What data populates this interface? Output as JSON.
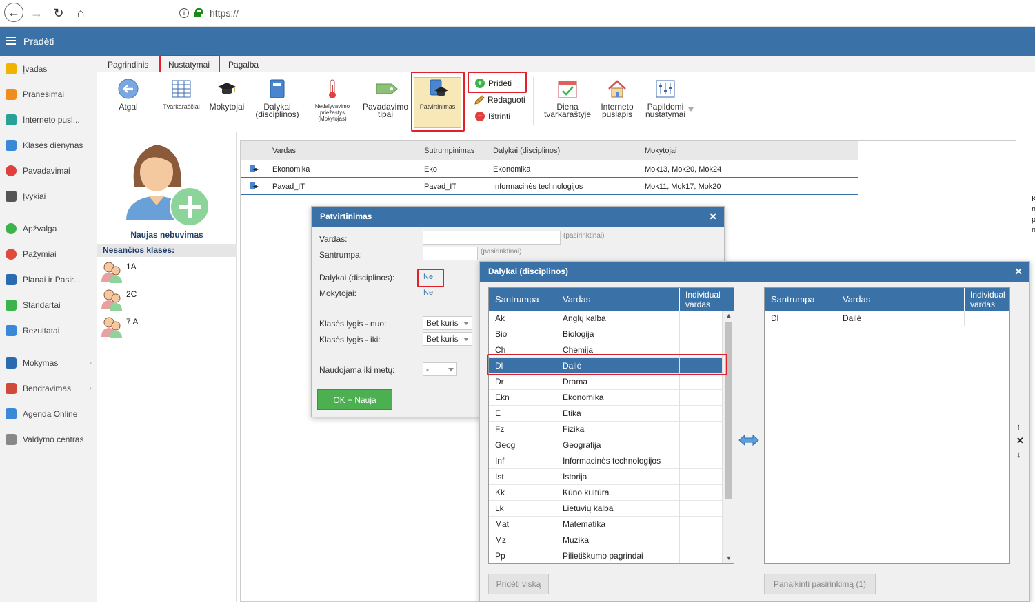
{
  "browser": {
    "url": "https://"
  },
  "app": {
    "title": "Pradėti"
  },
  "sidebar": {
    "items": [
      {
        "label": "Įvadas",
        "icon": "star-icon",
        "color": "#f0b400"
      },
      {
        "label": "Pranešimai",
        "icon": "envelope-icon",
        "color": "#f08c1e"
      },
      {
        "label": "Interneto pusl...",
        "icon": "house-icon",
        "color": "#2aa198"
      },
      {
        "label": "Klasės dienynas",
        "icon": "book-icon",
        "color": "#3a88d8"
      },
      {
        "label": "Pavadavimai",
        "icon": "user-icon",
        "color": "#e04040"
      },
      {
        "label": "Įvykiai",
        "icon": "calendar-icon",
        "color": "#555555"
      },
      {
        "label": "Apžvalga",
        "icon": "check-circle-icon",
        "color": "#3cb44b"
      },
      {
        "label": "Pažymiai",
        "icon": "grade-icon",
        "color": "#e04a3a"
      },
      {
        "label": "Planai ir Pasir...",
        "icon": "briefcase-icon",
        "color": "#2a6ab0"
      },
      {
        "label": "Standartai",
        "icon": "shield-icon",
        "color": "#3cb44b"
      },
      {
        "label": "Rezultatai",
        "icon": "bar-chart-icon",
        "color": "#3a88d8"
      },
      {
        "label": "Mokymas",
        "icon": "open-book-icon",
        "color": "#2a6ab0"
      },
      {
        "label": "Bendravimas",
        "icon": "chat-icon",
        "color": "#d04a3a"
      },
      {
        "label": "Agenda Online",
        "icon": "pencil-icon",
        "color": "#3a88d8"
      },
      {
        "label": "Valdymo centras",
        "icon": "gear-icon",
        "color": "#888888"
      }
    ]
  },
  "ribbon": {
    "tabs": [
      "Pagrindinis",
      "Nustatymai",
      "Pagalba"
    ],
    "buttons": {
      "atgal": "Atgal",
      "tvarkarasciai": "Tvarkaraščiai",
      "mokytojai": "Mokytojai",
      "dalykai_1": "Dalykai",
      "dalykai_2": "(disciplinos)",
      "nedalyvavimo_1": "Nedalyvavimo",
      "nedalyvavimo_2": "priežastys",
      "nedalyvavimo_3": "(Mokytojas)",
      "pavadavimo_1": "Pavadavimo",
      "pavadavimo_2": "tipai",
      "patvirtinimas": "Patvirtinimas",
      "prideti": "Pridėti",
      "redaguoti": "Redaguoti",
      "istrinti": "Ištrinti",
      "diena_1": "Diena",
      "diena_2": "tvarkaraštyje",
      "interneto_1": "Interneto",
      "interneto_2": "puslapis",
      "papildomi_1": "Papildomi",
      "papildomi_2": "nustatymai"
    }
  },
  "leftpanel": {
    "new_absence": "Naujas nebuvimas",
    "missing_header": "Nesančios klasės:",
    "classes": [
      "1A",
      "2C",
      "7 A"
    ]
  },
  "table": {
    "headers": [
      "Vardas",
      "Sutrumpinimas",
      "Dalykai (disciplinos)",
      "Mokytojai"
    ],
    "rows": [
      [
        "Ekonomika",
        "Eko",
        "Ekonomika",
        "Mok13, Mok20, Mok24"
      ],
      [
        "Pavad_IT",
        "Pavad_IT",
        "Informacinės technologijos",
        "Mok11, Mok17, Mok20"
      ]
    ]
  },
  "dialog1": {
    "title": "Patvirtinimas",
    "vardas_label": "Vardas:",
    "santrumpa_label": "Santrumpa:",
    "optional": "(pasirinktinai)",
    "dalykai_label": "Dalykai (disciplinos):",
    "dalykai_value": "Ne",
    "mokytojai_label": "Mokytojai:",
    "mokytojai_value": "Ne",
    "lygis_nuo_label": "Klasės lygis - nuo:",
    "lygis_nuo_value": "Bet kuris",
    "lygis_iki_label": "Klasės lygis - iki:",
    "lygis_iki_value": "Bet kuris",
    "naudojama_label": "Naudojama iki metų:",
    "naudojama_value": "-",
    "ok_button": "OK + Nauja"
  },
  "dialog2": {
    "title": "Dalykai (disciplinos)",
    "headers": [
      "Santrumpa",
      "Vardas",
      "Individual vardas"
    ],
    "subjects": [
      [
        "Ak",
        "Anglų kalba"
      ],
      [
        "Bio",
        "Biologija"
      ],
      [
        "Ch",
        "Chemija"
      ],
      [
        "Dl",
        "Dailė"
      ],
      [
        "Dr",
        "Drama"
      ],
      [
        "Ekn",
        "Ekonomika"
      ],
      [
        "E",
        "Etika"
      ],
      [
        "Fz",
        "Fizika"
      ],
      [
        "Geog",
        "Geografija"
      ],
      [
        "Inf",
        "Informacinės technologijos"
      ],
      [
        "Ist",
        "Istorija"
      ],
      [
        "Kk",
        "Kūno kultūra"
      ],
      [
        "Lk",
        "Lietuvių kalba"
      ],
      [
        "Mat",
        "Matematika"
      ],
      [
        "Mz",
        "Muzika"
      ],
      [
        "Pp",
        "Pilietiškumo pagrindai"
      ]
    ],
    "selected_index": 3,
    "headers_right": [
      "Santrumpa",
      "Vardas",
      "Individual vardas"
    ],
    "chosen": [
      [
        "Dl",
        "Dailė"
      ]
    ],
    "add_all": "Pridėti viską",
    "remove_selection": "Panaikinti pasirinkimą (1)"
  },
  "edge_text": [
    "K",
    "n",
    "p",
    "n"
  ]
}
